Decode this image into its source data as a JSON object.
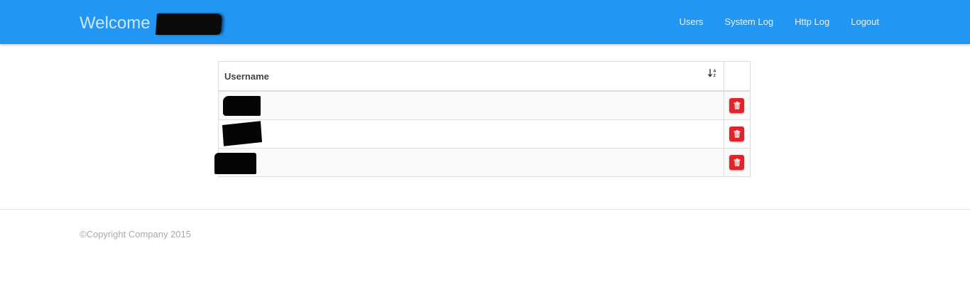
{
  "header": {
    "brand_text": "Welcome",
    "bg_color": "#2196f3",
    "nav_items": [
      {
        "label": "Users"
      },
      {
        "label": "System Log"
      },
      {
        "label": "Http Log"
      },
      {
        "label": "Logout"
      }
    ]
  },
  "table": {
    "columns": [
      "Username",
      ""
    ],
    "sort_icon": "sort-alpha-asc-icon",
    "rows": [
      {
        "username": "",
        "redacted": true,
        "action_icon": "trash-icon"
      },
      {
        "username": "",
        "redacted": true,
        "action_icon": "trash-icon"
      },
      {
        "username": "",
        "redacted": true,
        "action_icon": "trash-icon"
      }
    ],
    "delete_color": "#e0242a"
  },
  "footer": {
    "copyright": "©Copyright Company 2015"
  }
}
